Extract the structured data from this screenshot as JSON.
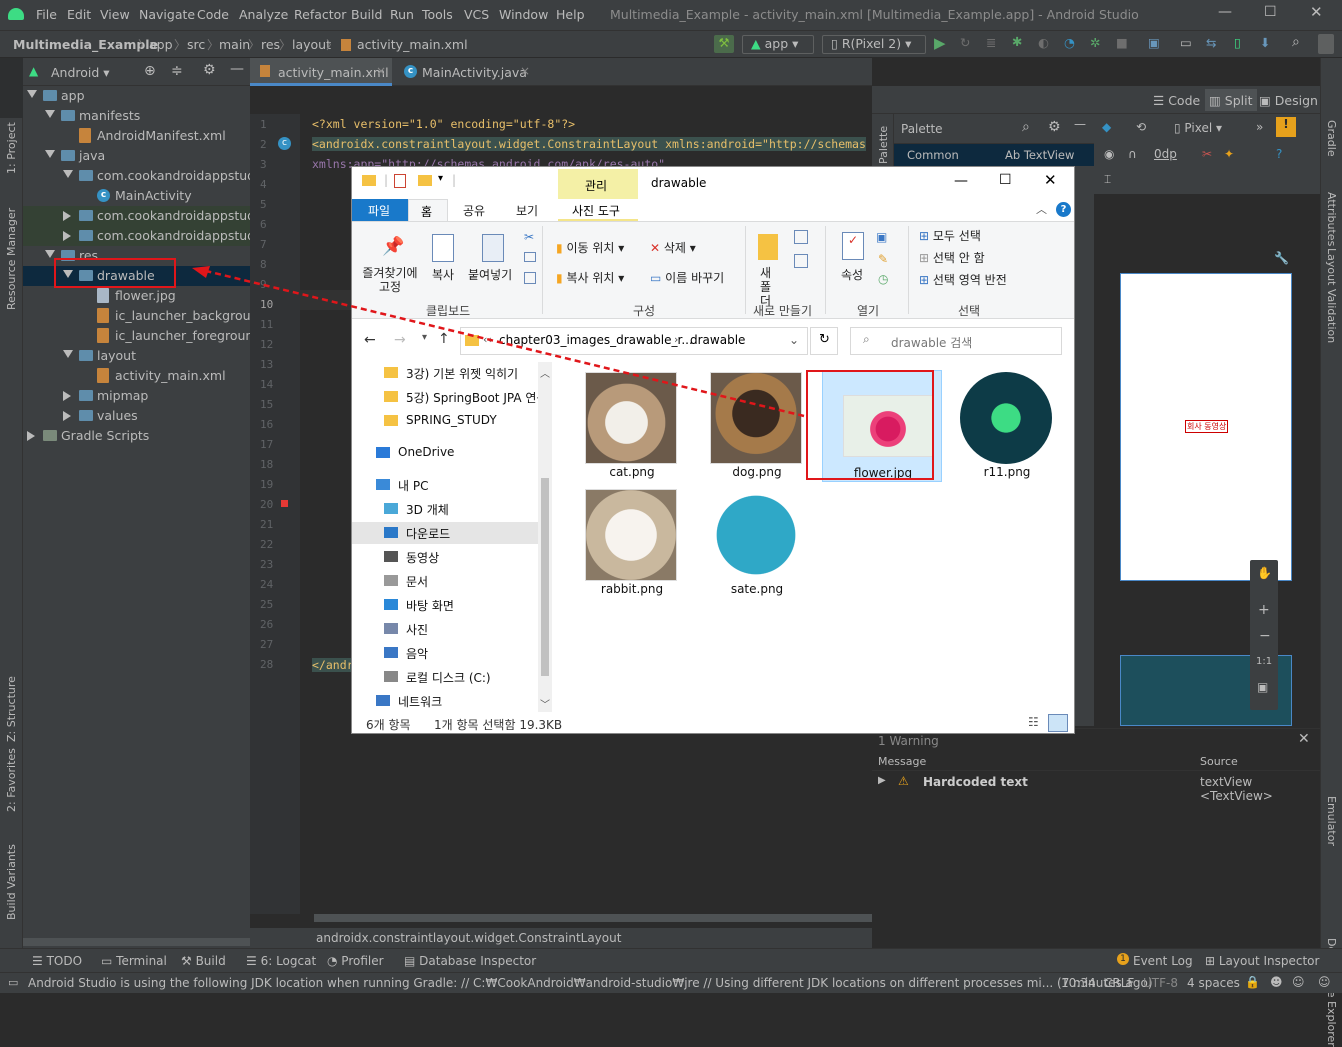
{
  "menubar": {
    "items": [
      "File",
      "Edit",
      "View",
      "Navigate",
      "Code",
      "Analyze",
      "Refactor",
      "Build",
      "Run",
      "Tools",
      "VCS",
      "Window",
      "Help"
    ],
    "window_title": "Multimedia_Example - activity_main.xml [Multimedia_Example.app] - Android Studio"
  },
  "navbar": {
    "breadcrumbs": [
      "Multimedia_Example",
      "app",
      "src",
      "main",
      "res",
      "layout",
      "activity_main.xml"
    ],
    "run_config": "app",
    "device": "R(Pixel 2)"
  },
  "project": {
    "view_mode": "Android",
    "tree": [
      {
        "label": "app",
        "depth": 0,
        "open": true,
        "type": "module"
      },
      {
        "label": "manifests",
        "depth": 1,
        "open": true,
        "type": "folder"
      },
      {
        "label": "AndroidManifest.xml",
        "depth": 2,
        "type": "file"
      },
      {
        "label": "java",
        "depth": 1,
        "open": true,
        "type": "folder"
      },
      {
        "label": "com.cookandroidappstudy.n",
        "depth": 2,
        "open": true,
        "type": "folder"
      },
      {
        "label": "MainActivity",
        "depth": 3,
        "type": "class"
      },
      {
        "label": "com.cookandroidappstudy.n",
        "depth": 2,
        "open": false,
        "type": "folder",
        "green": true
      },
      {
        "label": "com.cookandroidappstudy.n",
        "depth": 2,
        "open": false,
        "type": "folder",
        "green": true
      },
      {
        "label": "res",
        "depth": 1,
        "open": true,
        "type": "folder"
      },
      {
        "label": "drawable",
        "depth": 2,
        "open": true,
        "type": "folder",
        "selected": true
      },
      {
        "label": "flower.jpg",
        "depth": 3,
        "type": "file"
      },
      {
        "label": "ic_launcher_background.",
        "depth": 3,
        "type": "file"
      },
      {
        "label": "ic_launcher_foreground.x",
        "depth": 3,
        "type": "file"
      },
      {
        "label": "layout",
        "depth": 2,
        "open": true,
        "type": "folder"
      },
      {
        "label": "activity_main.xml",
        "depth": 3,
        "type": "file"
      },
      {
        "label": "mipmap",
        "depth": 2,
        "open": false,
        "type": "folder"
      },
      {
        "label": "values",
        "depth": 2,
        "open": false,
        "type": "folder"
      },
      {
        "label": "Gradle Scripts",
        "depth": 0,
        "open": false,
        "type": "gradle"
      }
    ]
  },
  "left_strip": [
    "1: Project",
    "Resource Manager",
    "Z: Structure",
    "2: Favorites",
    "Build Variants"
  ],
  "right_strip": [
    "Gradle",
    "Attributes",
    "Layout Validation",
    "Emulator",
    "Device File Explorer"
  ],
  "editor": {
    "tabs": [
      "activity_main.xml",
      "MainActivity.java"
    ],
    "line_numbers": [
      "1",
      "2",
      "3",
      "4",
      "5",
      "6",
      "7",
      "8",
      "9",
      "10",
      "11",
      "12",
      "13",
      "14",
      "15",
      "16",
      "17",
      "18",
      "19",
      "20",
      "21",
      "22",
      "23",
      "24",
      "25",
      "26",
      "27",
      "28"
    ],
    "line1": "<?xml version=\"1.0\" encoding=\"utf-8\"?>",
    "line2": "<androidx.constraintlayout.widget.ConstraintLayout xmlns:android=\"http://schemas",
    "line3": "    xmlns:app=\"http://schemas.android.com/apk/res-auto\"",
    "line28": "</andr",
    "footer": "androidx.constraintlayout.widget.ConstraintLayout"
  },
  "design": {
    "view_modes": [
      "Code",
      "Split",
      "Design"
    ],
    "palette_label": "Palette",
    "palette_category": "Common",
    "palette_item": "Ab TextView",
    "device": "Pixel",
    "margin": "0dp",
    "preview_text": "회사 동영상",
    "zoom_label": "1:1"
  },
  "problems": {
    "header": "1 Warning",
    "col_message": "Message",
    "col_source": "Source",
    "row_message": "Hardcoded text",
    "row_source": "textView <TextView>"
  },
  "bottom_tools": [
    "TODO",
    "Terminal",
    "Build",
    "6: Logcat",
    "Profiler",
    "Database Inspector",
    "Event Log",
    "Layout Inspector"
  ],
  "event_count": "1",
  "status": {
    "message": "Android Studio is using the following JDK location when running Gradle: // C:₩CookAndroid₩android-studio₩jre // Using different JDK locations on different processes mi... (7 minutes ago)",
    "position": "10:34",
    "line_sep": "CRLF",
    "encoding": "UTF-8",
    "indent": "4 spaces"
  },
  "explorer": {
    "context_tab": "관리",
    "title": "drawable",
    "tabs": [
      "파일",
      "홈",
      "공유",
      "보기",
      "사진 도구"
    ],
    "ribbon": {
      "pin": "즐겨찾기에 고정",
      "copy": "복사",
      "paste": "붙여넣기",
      "move_to": "이동 위치",
      "copy_to": "복사 위치",
      "delete": "삭제",
      "rename": "이름 바꾸기",
      "new_folder": "새 폴더",
      "properties": "속성",
      "select_all": "모두 선택",
      "select_none": "선택 안 함",
      "invert": "선택 영역 반전",
      "groups": [
        "클립보드",
        "구성",
        "새로 만들기",
        "열기",
        "선택"
      ]
    },
    "address": [
      "chapter03_images_drawable_r...",
      "drawable"
    ],
    "search_placeholder": "drawable 검색",
    "nav_items": [
      "3강) 기본 위젯 익히기",
      "5강) SpringBoot JPA 연동",
      "SPRING_STUDY",
      "OneDrive",
      "내 PC",
      "3D 개체",
      "다운로드",
      "동영상",
      "문서",
      "바탕 화면",
      "사진",
      "음악",
      "로컬 디스크 (C:)",
      "네트워크"
    ],
    "files": [
      "cat.png",
      "dog.png",
      "flower.jpg",
      "r11.png",
      "rabbit.png",
      "sate.png"
    ],
    "item_count": "6개 항목",
    "selection": "1개 항목 선택함 19.3KB"
  }
}
